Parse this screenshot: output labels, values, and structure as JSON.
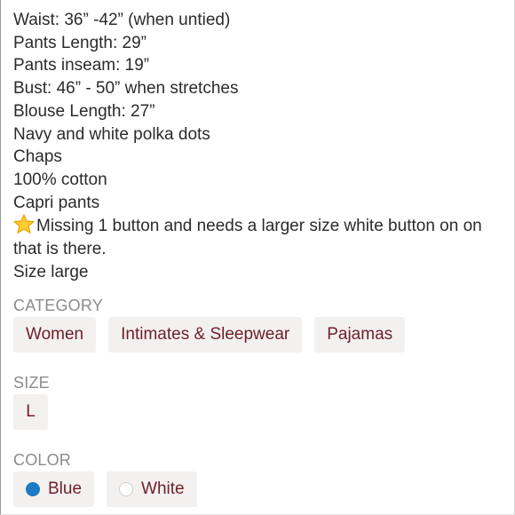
{
  "description": {
    "lines": [
      "Waist: 36” -42” (when untied)",
      "Pants Length: 29”",
      "Pants inseam: 19”",
      "Bust: 46” - 50” when stretches",
      "Blouse Length: 27”",
      "Navy and white polka dots",
      "Chaps",
      "100% cotton",
      "Capri pants"
    ],
    "note_icon": "star-emoji",
    "note": "Missing 1 button and needs a larger size white button on on that is there.",
    "size_line": "Size large"
  },
  "category": {
    "label": "CATEGORY",
    "items": [
      "Women",
      "Intimates & Sleepwear",
      "Pajamas"
    ]
  },
  "size": {
    "label": "SIZE",
    "value": "L"
  },
  "color": {
    "label": "COLOR",
    "items": [
      {
        "name": "Blue",
        "swatch": "#1f7ac4"
      },
      {
        "name": "White",
        "swatch": "#ffffff"
      }
    ]
  },
  "colors": {
    "chip_bg": "#f3f1ef",
    "chip_text": "#6e1f2a",
    "label_text": "#8b8b8b"
  }
}
